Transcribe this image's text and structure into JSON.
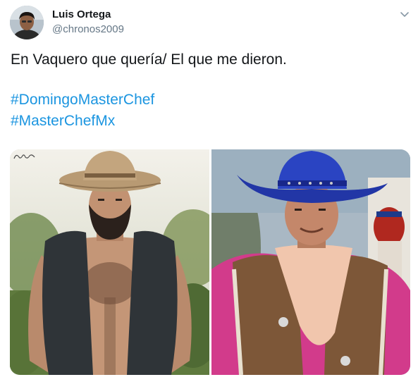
{
  "author": {
    "display_name": "Luis Ortega",
    "handle": "@chronos2009"
  },
  "tweet": {
    "text": "En Vaquero que quería/ El que me dieron.",
    "hashtags": [
      "#DomingoMasterChef",
      "#MasterChefMx"
    ]
  },
  "media": {
    "left_image": "cowboy-model-photo",
    "right_image": "cowboy-costume-photo"
  },
  "icons": {
    "menu": "chevron-down-icon"
  },
  "colors": {
    "text": "#14171a",
    "secondary_text": "#657786",
    "link": "#1b95e0"
  }
}
